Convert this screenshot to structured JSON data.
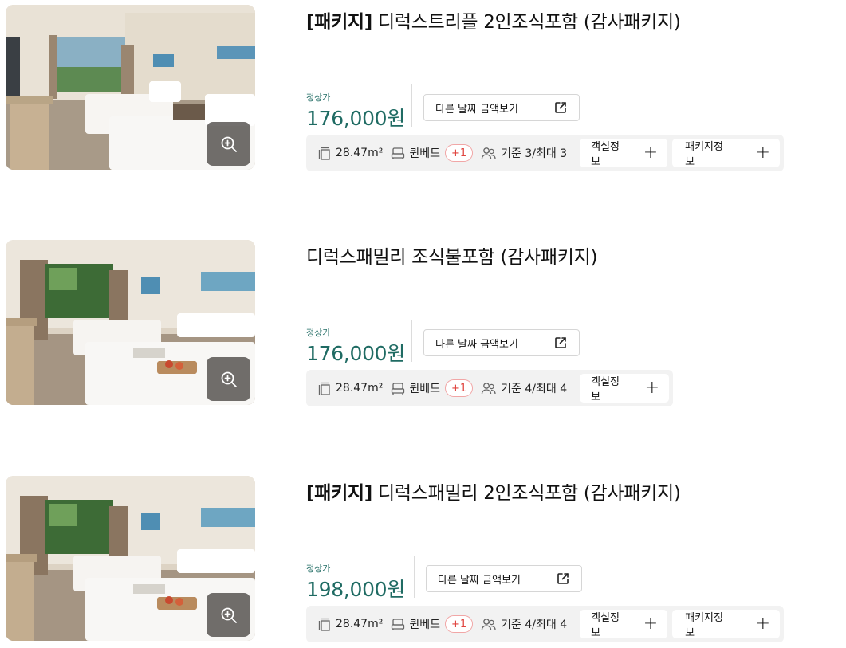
{
  "rooms": [
    {
      "title_prefix": "[패키지]",
      "title": "디럭스트리플 2인조식포함 (감사패키지)",
      "price_label": "정상가",
      "price": "176,000원",
      "other_date_label": "다른 날짜 금액보기",
      "area": "28.47m²",
      "bed": "퀸베드",
      "bed_extra": "+1",
      "capacity": "기준 3/최대 3",
      "room_info_label": "객실정보",
      "package_info_label": "패키지정보"
    },
    {
      "title_prefix": "",
      "title": "디럭스패밀리 조식불포함 (감사패키지)",
      "price_label": "정상가",
      "price": "176,000원",
      "other_date_label": "다른 날짜 금액보기",
      "area": "28.47m²",
      "bed": "퀸베드",
      "bed_extra": "+1",
      "capacity": "기준 4/최대 4",
      "room_info_label": "객실정보"
    },
    {
      "title_prefix": "[패키지]",
      "title": "디럭스패밀리 2인조식포함 (감사패키지)",
      "price_label": "정상가",
      "price": "198,000원",
      "other_date_label": "다른 날짜 금액보기",
      "area": "28.47m²",
      "bed": "퀸베드",
      "bed_extra": "+1",
      "capacity": "기준 4/최대 4",
      "room_info_label": "객실정보",
      "package_info_label": "패키지정보"
    }
  ],
  "colors": {
    "price": "#1f6b63",
    "badge": "#e0443f"
  },
  "icons": {
    "zoom": "zoom-in-icon",
    "external": "external-link-icon",
    "area": "area-icon",
    "bed": "bed-icon",
    "people": "people-icon",
    "plus": "plus-icon"
  }
}
